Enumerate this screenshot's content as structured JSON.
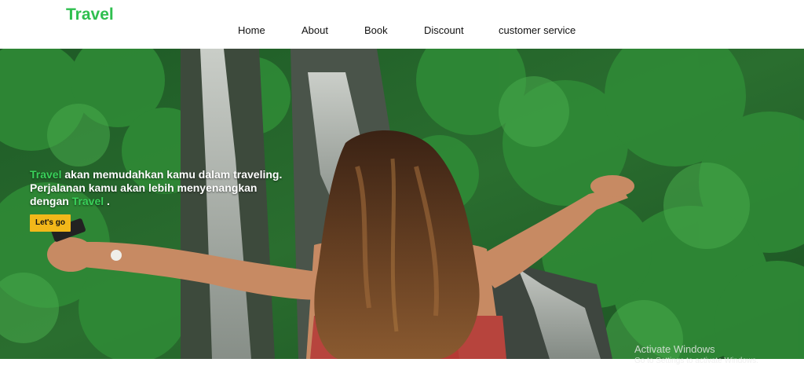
{
  "brand": {
    "name": "Travel"
  },
  "nav": {
    "items": [
      {
        "label": "Home"
      },
      {
        "label": "About"
      },
      {
        "label": "Book"
      },
      {
        "label": "Discount"
      },
      {
        "label": "customer service"
      }
    ]
  },
  "hero": {
    "line1_accent": "Travel",
    "line1_rest": " akan memudahkan kamu dalam traveling.",
    "line2": "Perjalanan kamu akan lebih menyenangkan",
    "line3_prefix": "dengan ",
    "line3_accent": "Travel",
    "line3_suffix": " .",
    "cta_label": "Let's go"
  },
  "watermark": {
    "title": "Activate Windows",
    "subtitle": "Go to Settings to activate Windows."
  },
  "colors": {
    "brand_green": "#2fbf4f",
    "cta_yellow": "#f2b81a",
    "foliage": "#2e7d32"
  }
}
